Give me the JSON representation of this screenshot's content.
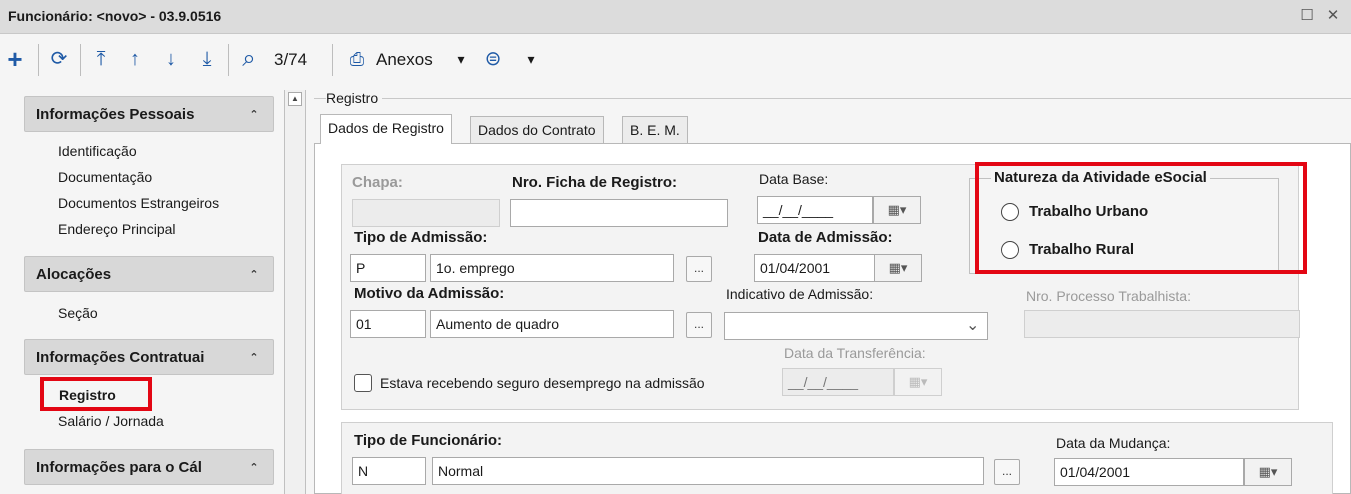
{
  "window": {
    "title": "Funcionário: <novo> - 03.9.0516",
    "maximize_glyph": "☐",
    "close_glyph": "✕"
  },
  "toolbar": {
    "record_counter": "3/74",
    "attachments_label": "Anexos",
    "icons": {
      "add": "+",
      "refresh": "⟳",
      "first": "⤒",
      "prev": "↑",
      "next": "↓",
      "last": "⤓",
      "search": "⌕",
      "attach": "⎙",
      "dropdown": "▾",
      "db": "⊜"
    }
  },
  "sidebar": {
    "sections": [
      {
        "label": "Informações Pessoais",
        "items": [
          "Identificação",
          "Documentação",
          "Documentos Estrangeiros",
          "Endereço Principal"
        ]
      },
      {
        "label": "Alocações",
        "items": [
          "Seção"
        ]
      },
      {
        "label": "Informações Contratuai",
        "items": [
          "Registro",
          "Salário / Jornada"
        ]
      },
      {
        "label": "Informações para o Cál",
        "items": []
      }
    ],
    "collapse_glyph": "⌃"
  },
  "main": {
    "group_label": "Registro",
    "tabs": [
      "Dados de Registro",
      "Dados do Contrato",
      "B. E. M."
    ],
    "form": {
      "chapa_label": "Chapa:",
      "chapa_value": "",
      "ficha_label": "Nro. Ficha de Registro:",
      "ficha_value": "",
      "data_base_label": "Data Base:",
      "data_base_value": "__/__/____",
      "tipo_admissao_label": "Tipo de Admissão:",
      "tipo_admissao_code": "P",
      "tipo_admissao_desc": "1o. emprego",
      "data_admissao_label": "Data de Admissão:",
      "data_admissao_value": "01/04/2001",
      "motivo_label": "Motivo da Admissão:",
      "motivo_code": "01",
      "motivo_desc": "Aumento de quadro",
      "indicativo_label": "Indicativo de Admissão:",
      "indicativo_value": "",
      "processo_label": "Nro. Processo Trabalhista:",
      "processo_value": "",
      "transferencia_label": "Data da Transferência:",
      "transferencia_value": "__/__/____",
      "seguro_label": "Estava recebendo seguro desemprego na admissão",
      "natureza_legend": "Natureza da Atividade eSocial",
      "natureza_options": [
        "Trabalho Urbano",
        "Trabalho Rural"
      ],
      "tipo_func_label": "Tipo de Funcionário:",
      "tipo_func_code": "N",
      "tipo_func_desc": "Normal",
      "data_mudanca_label": "Data da Mudança:",
      "data_mudanca_value": "01/04/2001",
      "ellipsis": "...",
      "calendar_glyph": "▦▾",
      "select_chevron": "⌄"
    }
  },
  "colors": {
    "highlight": "#e30613",
    "toolbar_icon": "#1f5aa6"
  }
}
